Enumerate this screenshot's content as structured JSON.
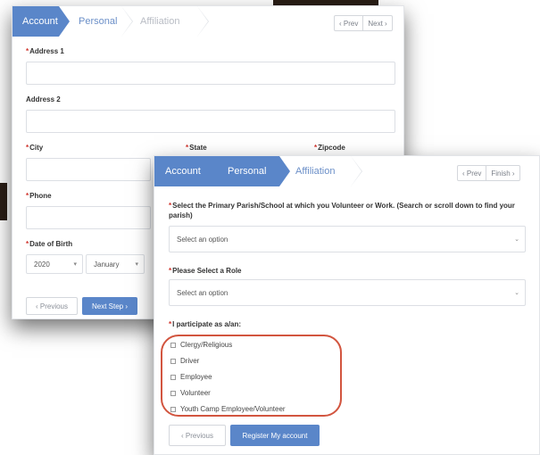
{
  "panel_back": {
    "steps": [
      "Account",
      "Personal",
      "Affiliation"
    ],
    "pager": {
      "prev": "‹ Prev",
      "next": "Next ›"
    },
    "fields": {
      "address1": "Address 1",
      "address2": "Address 2",
      "city": "City",
      "state": "State",
      "zipcode": "Zipcode",
      "phone": "Phone",
      "dob": "Date of Birth"
    },
    "dob_values": {
      "year": "2020",
      "month": "January"
    },
    "buttons": {
      "previous": "‹ Previous",
      "next": "Next Step ›"
    },
    "required_mark": "*"
  },
  "panel_front": {
    "steps": [
      "Account",
      "Personal",
      "Affiliation"
    ],
    "pager": {
      "prev": "‹ Prev",
      "finish": "Finish ›"
    },
    "parish_label": "Select the Primary Parish/School at which you Volunteer or Work. (Search or scroll down to find your parish)",
    "parish_placeholder": "Select an option",
    "role_label": "Please Select a Role",
    "role_placeholder": "Select an option",
    "participate_label": "I participate as a/an:",
    "options": [
      "Clergy/Religious",
      "Driver",
      "Employee",
      "Volunteer",
      "Youth Camp Employee/Volunteer"
    ],
    "buttons": {
      "previous": "‹ Previous",
      "register": "Register My account"
    },
    "required_mark": "*"
  },
  "colors": {
    "accent": "#5a86c9",
    "highlight": "#d2553f",
    "required": "#d0342c"
  }
}
